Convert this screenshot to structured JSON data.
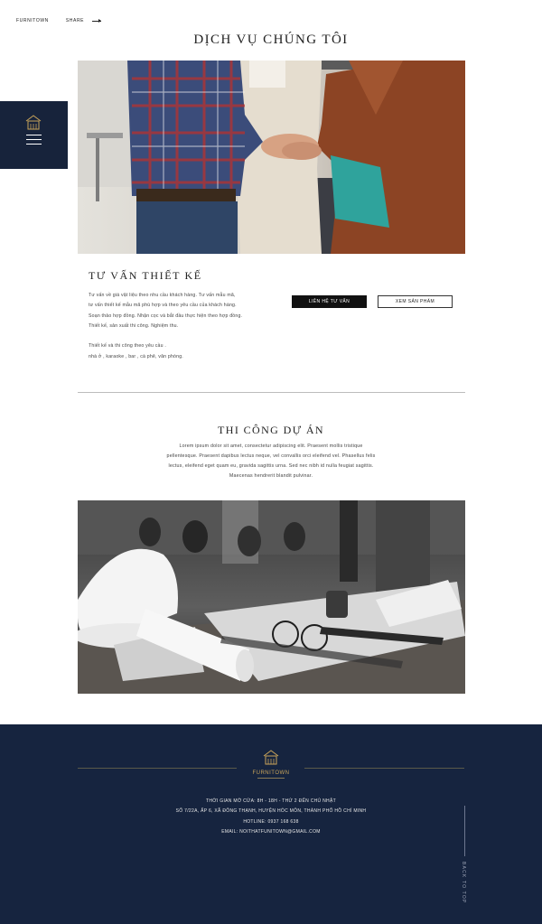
{
  "topbar": {
    "brand": "FURNITOWN",
    "share": "SHARE"
  },
  "colors": {
    "navy": "#17233b",
    "gold": "#c9a45a"
  },
  "nav": {
    "logo_icon": "house-logo-icon",
    "menu_icon": "hamburger-menu-icon"
  },
  "section_services": {
    "title": "DỊCH VỤ CHÚNG TÔI",
    "photo": "handshake-photo"
  },
  "service_design": {
    "title": "TƯ VẤN THIẾT KẾ",
    "lines": [
      "Tư vấn về giá vật liệu theo nhu cầu khách hàng. Tư vấn mẫu mã,",
      "tư vấn thiết kế mẫu mã phù hợp và theo yêu cầu của khách hàng.",
      "Soạn thảo hợp đồng. Nhận cọc và bắt đầu thực hiện theo hợp đồng.",
      "Thiết kế, sản xuất thi công. Nghiệm thu.",
      "",
      "Thiết kế và thi công theo yêu cầu .",
      "nhà ở , karaoke , bar , cà phê, văn phòng."
    ],
    "btn_contact": "LIÊN HỆ TƯ VẤN",
    "btn_products": "XEM SẢN PHẨM"
  },
  "section_construction": {
    "title": "THI CÔNG DỰ ÁN",
    "lines": [
      "Lorem ipsum dolor sit amet, consectetur adipiscing elit. Praesent mollis tristique",
      "pellentesque. Praesent dapibus lectus neque, vel convallis orci eleifend vel. Phasellus felis",
      "lectus, eleifend eget quam eu, gravida sagittis urna. Sed nec nibh id nulla feugiat sagittis.",
      "Maecenas hendrerit blandit pulvinar."
    ],
    "photo": "construction-desk-photo"
  },
  "footer": {
    "logo_name": "FURNITOWN",
    "lines": [
      "THỜI GIAN MỞ CỬA: 8H - 18H  - THỨ 2 ĐẾN CHỦ NHẬT",
      "SỐ 7/22A, ẤP 6, XÃ ĐÔNG THẠNH, HUYỆN HÓC MÔN, THÀNH PHỐ HỒ CHÍ MINH",
      "HOTLINE: 0937 168 638",
      "EMAIL: NOITHATFUNITOWN@GMAIL.COM"
    ],
    "back_to_top": "BACK TO TOP"
  }
}
